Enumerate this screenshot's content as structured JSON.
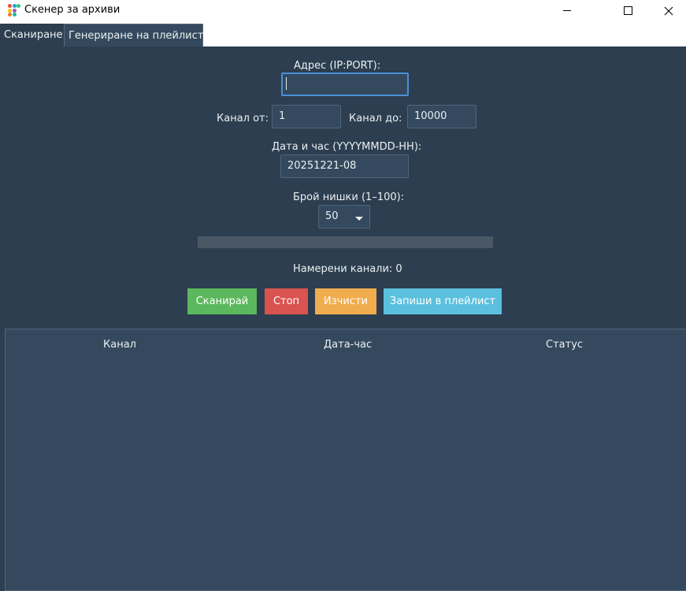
{
  "window": {
    "title": "Скенер за архиви"
  },
  "tabs": [
    {
      "label": "Сканиране",
      "active": true
    },
    {
      "label": "Генериране на плейлист",
      "active": false
    }
  ],
  "form": {
    "address_label": "Адрес (IP:PORT):",
    "address_value": "",
    "channel_from_label": "Канал от:",
    "channel_from_value": "1",
    "channel_to_label": "Канал до:",
    "channel_to_value": "10000",
    "datetime_label": "Дата и час (YYYYMMDD-HH):",
    "datetime_value": "20251221-08",
    "threads_label": "Брой нишки (1–100):",
    "threads_value": "50"
  },
  "progress": {
    "value_percent": 0
  },
  "found_channels_text": "Намерени канали: 0",
  "buttons": {
    "scan": "Сканирай",
    "stop": "Стоп",
    "clear": "Изчисти",
    "save_playlist": "Запиши в плейлист"
  },
  "table": {
    "columns": [
      "Канал",
      "Дата-час",
      "Статус"
    ],
    "rows": []
  },
  "colors": {
    "background": "#2c3e50",
    "scan": "#5cb85c",
    "stop": "#d9534f",
    "clear": "#f0ad4e",
    "save": "#5bc0de",
    "focus": "#4a90d9"
  }
}
